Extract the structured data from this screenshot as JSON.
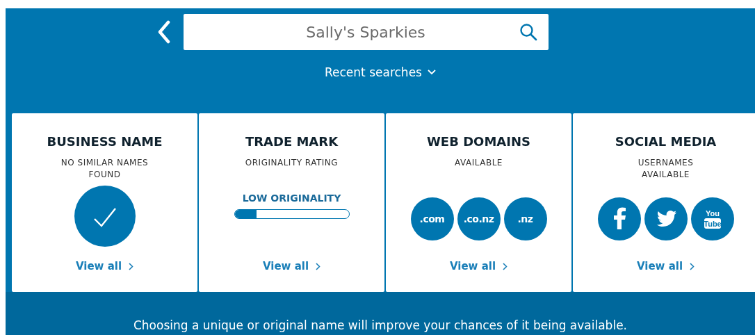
{
  "search": {
    "value": "Sally's Sparkies"
  },
  "recent_searches": {
    "label": "Recent searches",
    "expanded": false
  },
  "cards": [
    {
      "kind": "check",
      "title": "BUSINESS NAME",
      "subtitle": "NO SIMILAR NAMES FOUND",
      "link": "View all"
    },
    {
      "kind": "meter",
      "title": "TRADE MARK",
      "subtitle": "ORIGINALITY RATING",
      "rating": "LOW ORIGINALITY",
      "level": 0.19,
      "link": "View all"
    },
    {
      "kind": "domains",
      "title": "WEB DOMAINS",
      "subtitle": "AVAILABLE",
      "domains": [
        ".com",
        ".co.nz",
        ".nz"
      ],
      "link": "View all"
    },
    {
      "kind": "social",
      "title": "SOCIAL MEDIA",
      "subtitle": "USERNAMES AVAILABLE",
      "networks": [
        {
          "kind": "facebook"
        },
        {
          "kind": "twitter"
        },
        {
          "kind": "youtube",
          "logo_top": "You",
          "logo_bottom": "Tube"
        }
      ],
      "link": "View all"
    }
  ],
  "footer_note": "Choosing a unique or original name will improve your chances of it being available."
}
